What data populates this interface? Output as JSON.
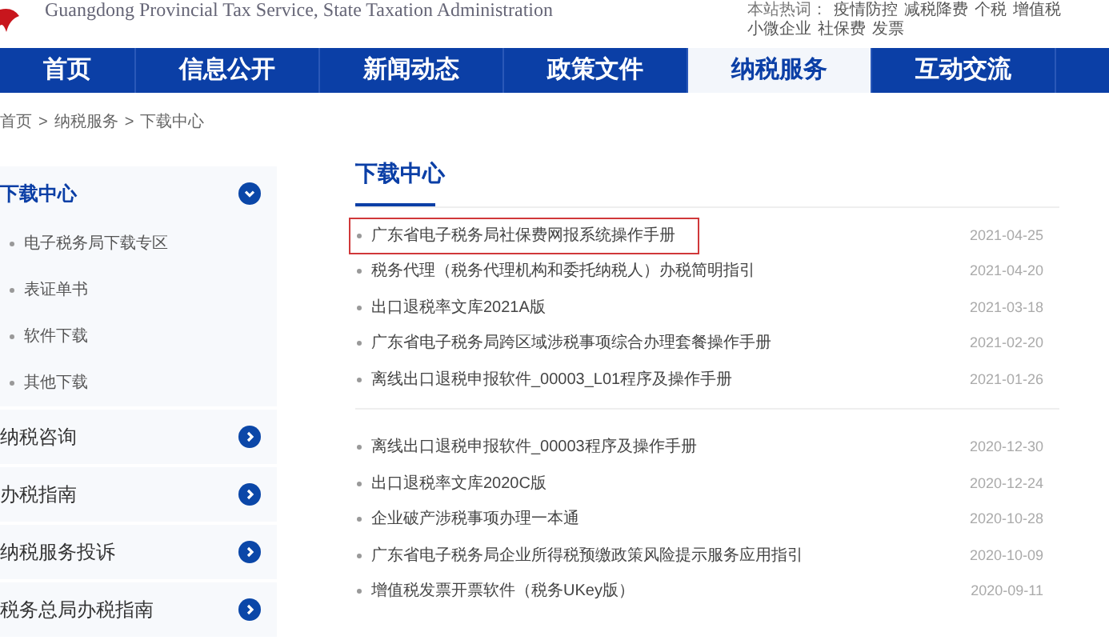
{
  "header": {
    "subtitle": "Guangdong Provincial Tax Service, State Taxation Administration",
    "hot_label": "本站热词：",
    "hot_words": [
      "疫情防控",
      "减税降费",
      "个税",
      "增值税",
      "小微企业",
      "社保费",
      "发票"
    ]
  },
  "nav": [
    {
      "label": "首页",
      "selected": false
    },
    {
      "label": "信息公开",
      "selected": false
    },
    {
      "label": "新闻动态",
      "selected": false
    },
    {
      "label": "政策文件",
      "selected": false
    },
    {
      "label": "纳税服务",
      "selected": true
    },
    {
      "label": "互动交流",
      "selected": false
    }
  ],
  "breadcrumb": [
    "首页",
    "纳税服务",
    "下载中心"
  ],
  "breadcrumb_separator": ">",
  "sidebar": [
    {
      "label": "下载中心",
      "expanded": true,
      "children": [
        {
          "label": "电子税务局下载专区"
        },
        {
          "label": "表证单书"
        },
        {
          "label": "软件下载"
        },
        {
          "label": "其他下载"
        }
      ]
    },
    {
      "label": "纳税咨询",
      "expanded": false
    },
    {
      "label": "办税指南",
      "expanded": false
    },
    {
      "label": "纳税服务投诉",
      "expanded": false
    },
    {
      "label": "税务总局办税指南",
      "expanded": false
    }
  ],
  "main": {
    "title": "下载中心",
    "groups": [
      [
        {
          "title": "广东省电子税务局社保费网报系统操作手册",
          "date": "2021-04-25",
          "highlighted": true
        },
        {
          "title": "税务代理（税务代理机构和委托纳税人）办税简明指引",
          "date": "2021-04-20",
          "highlighted": false
        },
        {
          "title": "出口退税率文库2021A版",
          "date": "2021-03-18",
          "highlighted": false
        },
        {
          "title": "广东省电子税务局跨区域涉税事项综合办理套餐操作手册",
          "date": "2021-02-20",
          "highlighted": false
        },
        {
          "title": "离线出口退税申报软件_00003_L01程序及操作手册",
          "date": "2021-01-26",
          "highlighted": false
        }
      ],
      [
        {
          "title": "离线出口退税申报软件_00003程序及操作手册",
          "date": "2020-12-30",
          "highlighted": false
        },
        {
          "title": "出口退税率文库2020C版",
          "date": "2020-12-24",
          "highlighted": false
        },
        {
          "title": "企业破产涉税事项办理一本通",
          "date": "2020-10-28",
          "highlighted": false
        },
        {
          "title": "广东省电子税务局企业所得税预缴政策风险提示服务应用指引",
          "date": "2020-10-09",
          "highlighted": false
        },
        {
          "title": "增值税发票开票软件（税务UKey版）",
          "date": "2020-09-11",
          "highlighted": false
        }
      ]
    ]
  }
}
